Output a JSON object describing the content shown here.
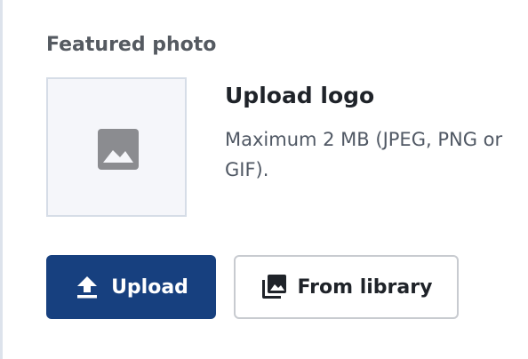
{
  "featured": {
    "title": "Featured photo",
    "thumbnail_icon": "image-icon"
  },
  "upload": {
    "title": "Upload logo",
    "description": "Maximum 2 MB (JPEG, PNG or GIF)."
  },
  "actions": {
    "upload_label": "Upload",
    "upload_icon": "upload-icon",
    "library_label": "From library",
    "library_icon": "photo-library-icon"
  },
  "colors": {
    "primary": "#17407f",
    "thumbnail_bg": "#f5f6fa",
    "border": "#c8cbd0"
  }
}
